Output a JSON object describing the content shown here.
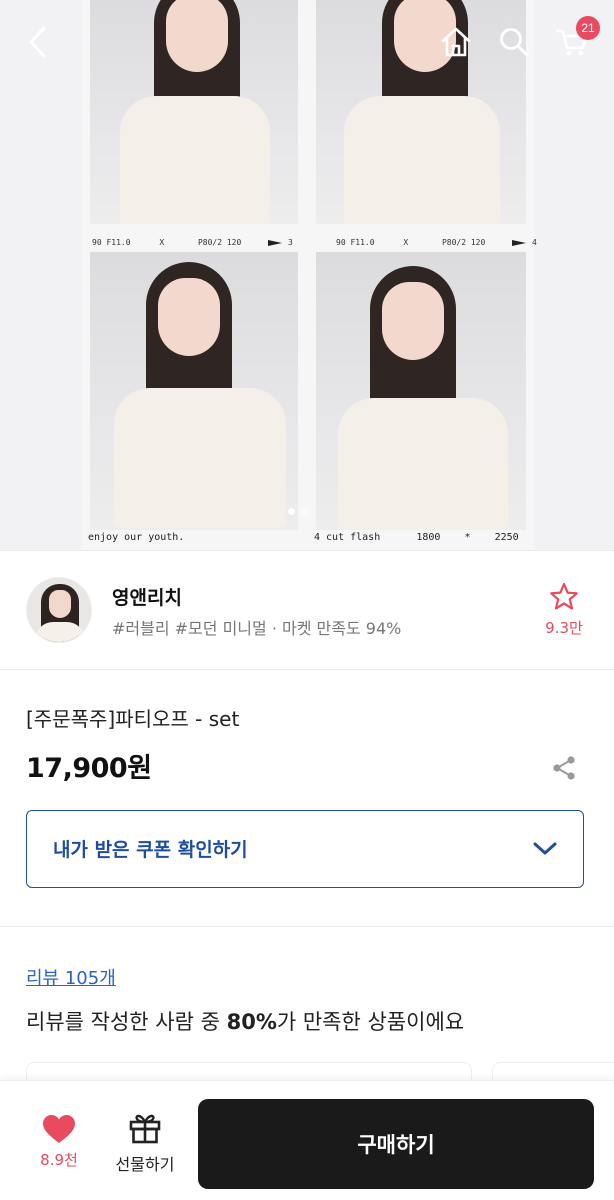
{
  "header": {
    "back_icon": "chevron-left-icon",
    "home_icon": "home-icon",
    "search_icon": "search-icon",
    "cart_icon": "cart-icon",
    "cart_count": "21"
  },
  "gallery": {
    "frame_labels": [
      "90 F11.0      X       P80/2 120",
      "90 F11.0      X       P80/2 120"
    ],
    "frame_numbers": [
      "3",
      "4"
    ],
    "caption_left": "enjoy our youth.",
    "caption_right": "4 cut flash      1800    *    2250",
    "page_dots": 2,
    "active_dot": 0
  },
  "seller": {
    "name": "영앤리치",
    "tags": "#러블리 #모던 미니멀 · 마켓 만족도 94%",
    "follow_count": "9.3만",
    "star_color": "#e84a5f"
  },
  "product": {
    "title": "[주문폭주]파티오프 - set",
    "price": "17,900원",
    "coupon_label": "내가 받은 쿠폰 확인하기"
  },
  "review": {
    "link_label": "리뷰 105개",
    "summary_prefix": "리뷰를 작성한 사람 중 ",
    "summary_percent": "80%",
    "summary_suffix": "가 만족한 상품이에요"
  },
  "bottom_bar": {
    "like_count": "8.9천",
    "gift_label": "선물하기",
    "buy_label": "구매하기",
    "accent": "#e84a5f",
    "buy_bg": "#1a1a1a"
  }
}
